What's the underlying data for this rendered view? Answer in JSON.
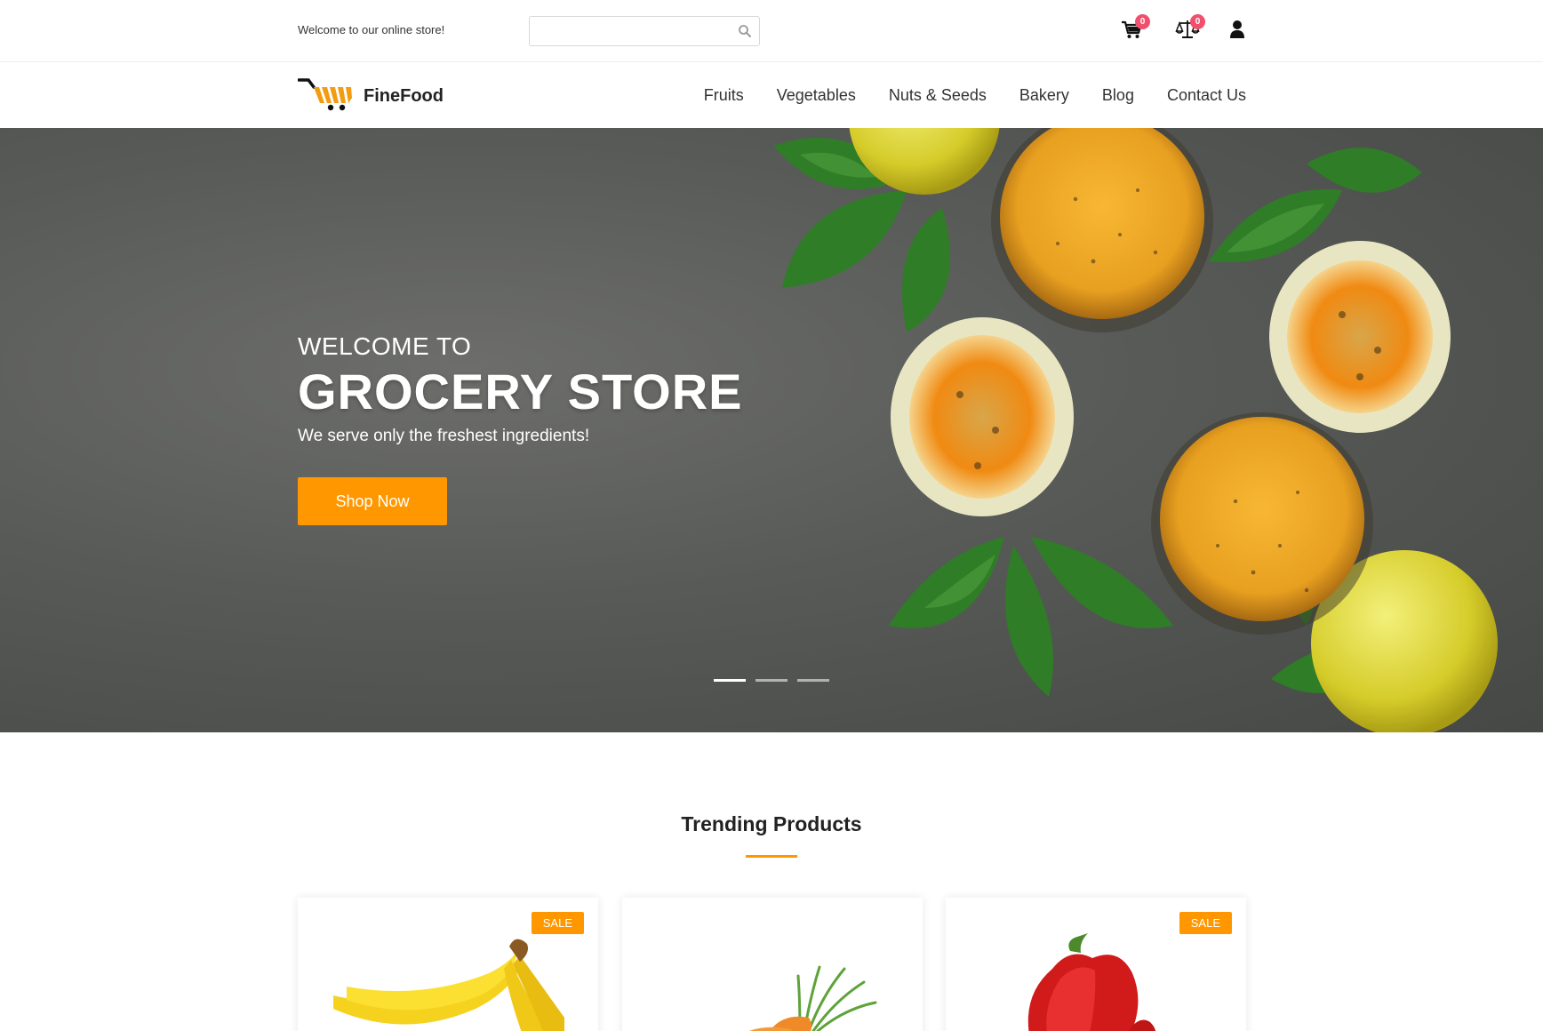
{
  "topbar": {
    "welcome": "Welcome to our online store!",
    "search_placeholder": "",
    "search_icon": "search-icon",
    "cart_icon": "cart-icon",
    "cart_count": "0",
    "compare_icon": "scale-icon",
    "compare_count": "0",
    "user_icon": "user-icon"
  },
  "header": {
    "brand": "FineFood",
    "logo_icon": "shopping-cart-logo-icon",
    "nav": [
      "Fruits",
      "Vegetables",
      "Nuts & Seeds",
      "Bakery",
      "Blog",
      "Contact Us"
    ]
  },
  "hero": {
    "subtitle": "WELCOME TO",
    "title": "GROCERY STORE",
    "tagline": "We serve only the freshest ingredients!",
    "button": "Shop Now",
    "slides": 3,
    "active_slide": 1
  },
  "trending": {
    "title": "Trending Products",
    "products": [
      {
        "image": "bananas",
        "badge": "SALE"
      },
      {
        "image": "carrots",
        "badge": ""
      },
      {
        "image": "red-bell-pepper",
        "badge": "SALE"
      }
    ]
  },
  "colors": {
    "accent": "#ff9800",
    "badge": "#f0506e",
    "text": "#222222"
  }
}
